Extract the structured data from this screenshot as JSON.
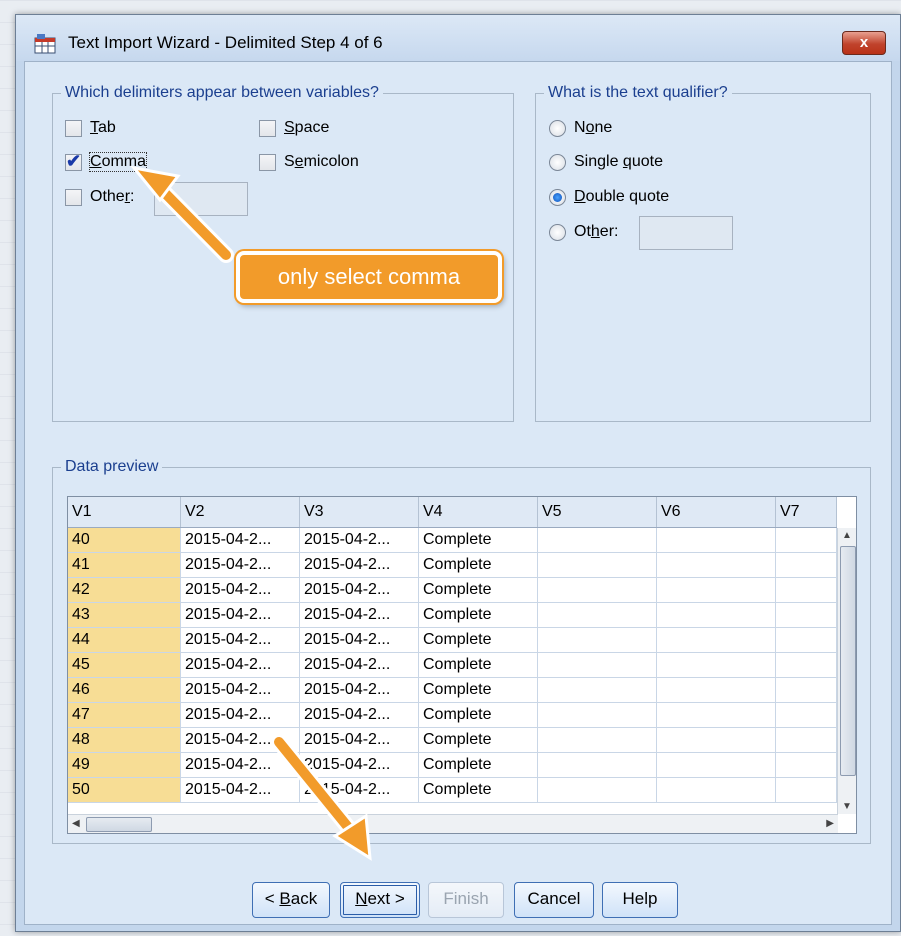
{
  "window": {
    "title": "Text Import Wizard - Delimited Step 4 of 6",
    "close_label": "x"
  },
  "delimiters": {
    "legend": "Which delimiters appear between variables?",
    "tab": {
      "pre": "",
      "u": "T",
      "post": "ab",
      "checked": false
    },
    "space": {
      "pre": "",
      "u": "S",
      "post": "pace",
      "checked": false
    },
    "comma": {
      "pre": "",
      "u": "C",
      "post": "omma",
      "checked": true
    },
    "semicolon": {
      "pre": "S",
      "u": "e",
      "post": "micolon",
      "checked": false
    },
    "other": {
      "pre": "Othe",
      "u": "r",
      "post": ":",
      "checked": false,
      "value": ""
    }
  },
  "qualifier": {
    "legend": "What is the text qualifier?",
    "none": {
      "pre": "N",
      "u": "o",
      "post": "ne",
      "selected": false
    },
    "single": {
      "pre": "Single ",
      "u": "q",
      "post": "uote",
      "selected": false
    },
    "double": {
      "pre": "",
      "u": "D",
      "post": "ouble quote",
      "selected": true
    },
    "other": {
      "pre": "Ot",
      "u": "h",
      "post": "er:",
      "selected": false,
      "value": ""
    }
  },
  "preview": {
    "legend": "Data preview",
    "columns": [
      "V1",
      "V2",
      "V3",
      "V4",
      "V5",
      "V6",
      "V7"
    ],
    "rows": [
      [
        "40",
        "2015-04-2...",
        "2015-04-2...",
        "Complete",
        "",
        "",
        ""
      ],
      [
        "41",
        "2015-04-2...",
        "2015-04-2...",
        "Complete",
        "",
        "",
        ""
      ],
      [
        "42",
        "2015-04-2...",
        "2015-04-2...",
        "Complete",
        "",
        "",
        ""
      ],
      [
        "43",
        "2015-04-2...",
        "2015-04-2...",
        "Complete",
        "",
        "",
        ""
      ],
      [
        "44",
        "2015-04-2...",
        "2015-04-2...",
        "Complete",
        "",
        "",
        ""
      ],
      [
        "45",
        "2015-04-2...",
        "2015-04-2...",
        "Complete",
        "",
        "",
        ""
      ],
      [
        "46",
        "2015-04-2...",
        "2015-04-2...",
        "Complete",
        "",
        "",
        ""
      ],
      [
        "47",
        "2015-04-2...",
        "2015-04-2...",
        "Complete",
        "",
        "",
        ""
      ],
      [
        "48",
        "2015-04-2...",
        "2015-04-2...",
        "Complete",
        "",
        "",
        ""
      ],
      [
        "49",
        "2015-04-2...",
        "2015-04-2...",
        "Complete",
        "",
        "",
        ""
      ],
      [
        "50",
        "2015-04-2...",
        "2015-04-2...",
        "Complete",
        "",
        "",
        ""
      ]
    ]
  },
  "buttons": {
    "back": {
      "pre": "< ",
      "u": "B",
      "post": "ack"
    },
    "next": {
      "pre": "",
      "u": "N",
      "post": "ext >"
    },
    "finish": "Finish",
    "cancel": "Cancel",
    "help": "Help"
  },
  "annotation": {
    "callout_text": "only select comma",
    "arrow_color": "#f29b2a"
  }
}
